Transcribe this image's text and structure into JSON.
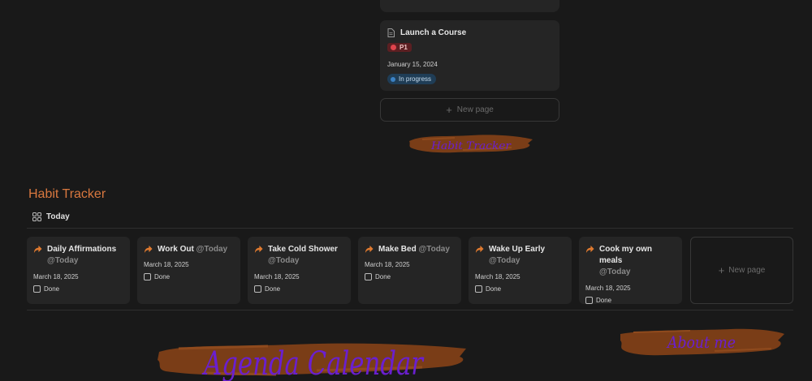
{
  "task": {
    "title": "Launch a Course",
    "priority": "P1",
    "date": "January 15, 2024",
    "status": "In progress",
    "icon": "page-icon"
  },
  "new_page_label": "New page",
  "banners": {
    "top": "Habit Tracker",
    "bottom_left": "Agenda Calendar",
    "bottom_right": "About me"
  },
  "habit_tracker": {
    "title": "Habit Tracker",
    "view_label": "Today",
    "view_icon": "gallery-icon",
    "cards": [
      {
        "name": "Daily Affirmations",
        "mention": "@Today",
        "date": "March 18, 2025",
        "done_label": "Done",
        "done": false
      },
      {
        "name": "Work Out",
        "mention": "@Today",
        "date": "March 18, 2025",
        "done_label": "Done",
        "done": false
      },
      {
        "name": "Take Cold Shower",
        "mention": "@Today",
        "date": "March 18, 2025",
        "done_label": "Done",
        "done": false
      },
      {
        "name": "Make Bed",
        "mention": "@Today",
        "date": "March 18, 2025",
        "done_label": "Done",
        "done": false
      },
      {
        "name": "Wake Up Early",
        "mention": "@Today",
        "date": "March 18, 2025",
        "done_label": "Done",
        "done": false
      },
      {
        "name": "Cook my own meals",
        "mention": "@Today",
        "date": "March 18, 2025",
        "done_label": "Done",
        "done": false
      }
    ],
    "new_page_label": "New page"
  },
  "colors": {
    "background": "#191919",
    "card": "#252525",
    "accent": "#d9783f",
    "brush": "#7a3d17",
    "script_text": "#6a1fd0"
  }
}
